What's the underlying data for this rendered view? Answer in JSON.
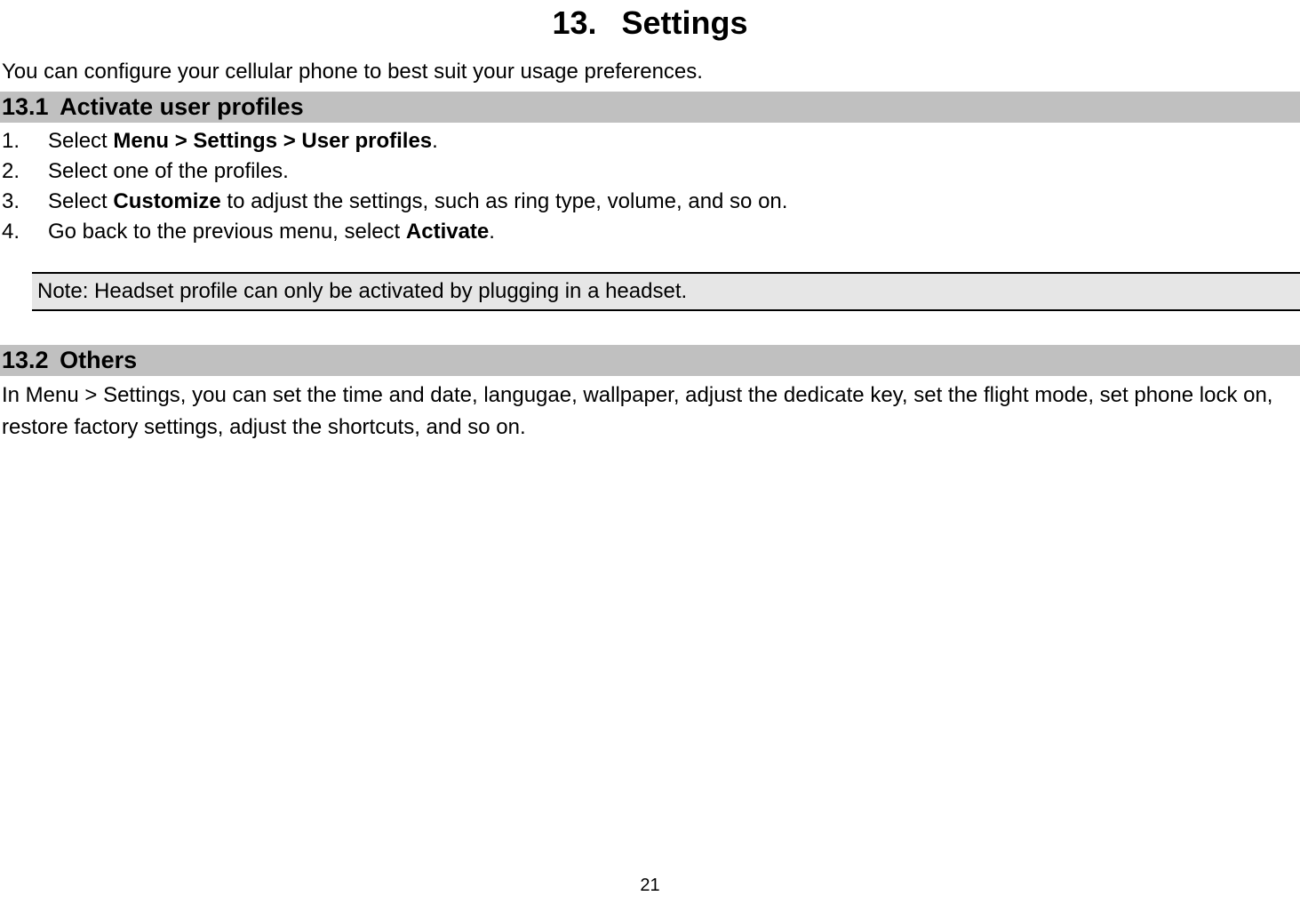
{
  "page": {
    "title_number": "13.",
    "title_text": "Settings",
    "intro": "You can configure your cellular phone to best suit your usage preferences.",
    "page_number": "21"
  },
  "sections": {
    "s1": {
      "number": "13.1",
      "title": "Activate user profiles",
      "steps": [
        {
          "num": "1.",
          "prefix": "Select ",
          "bold": "Menu > Settings > User profiles",
          "suffix": "."
        },
        {
          "num": "2.",
          "prefix": "Select one of the profiles.",
          "bold": "",
          "suffix": ""
        },
        {
          "num": "3.",
          "prefix": "Select ",
          "bold": "Customize",
          "suffix": " to adjust the settings, such as ring type, volume, and so on."
        },
        {
          "num": "4.",
          "prefix": "Go back to the previous menu, select ",
          "bold": "Activate",
          "suffix": "."
        }
      ],
      "note": {
        "label": "Note:",
        "text": " Headset profile can only be activated by plugging in a headset."
      }
    },
    "s2": {
      "number": "13.2",
      "title": "Others",
      "paragraph": "In Menu > Settings, you can set the time and date, langugae, wallpaper, adjust the dedicate key, set the flight mode, set phone lock on, restore factory settings, adjust the shortcuts, and so on."
    }
  }
}
